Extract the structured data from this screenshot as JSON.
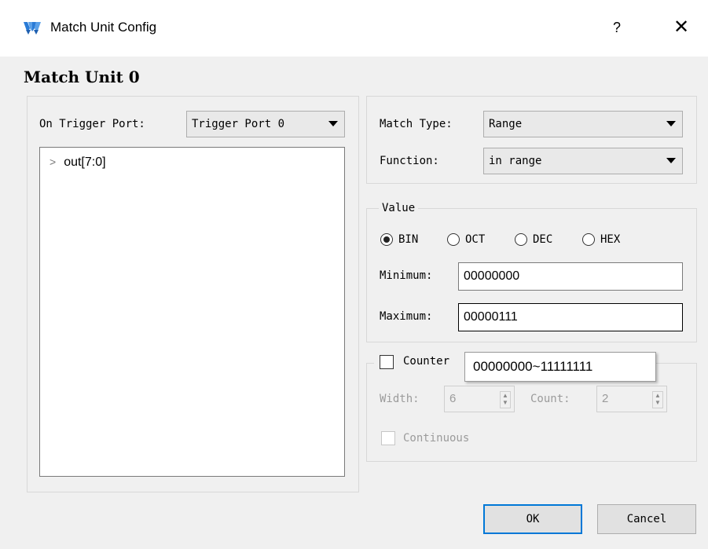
{
  "window": {
    "title": "Match Unit Config",
    "help_label": "?",
    "close_label": "✕",
    "logo_icon": "gowin-logo-icon",
    "accent_color": "#1e6ec8"
  },
  "heading": "Match Unit 0",
  "trigger": {
    "label": "On Trigger Port:",
    "value": "Trigger Port 0"
  },
  "tree": {
    "items": [
      {
        "label": "out[7:0]",
        "expanded": false
      }
    ]
  },
  "match": {
    "type_label": "Match Type:",
    "type_value": "Range",
    "function_label": "Function:",
    "function_value": "in range"
  },
  "value_group": {
    "title": "Value",
    "radios": [
      {
        "label": "BIN",
        "checked": true
      },
      {
        "label": "OCT",
        "checked": false
      },
      {
        "label": "DEC",
        "checked": false
      },
      {
        "label": "HEX",
        "checked": false
      }
    ],
    "minimum_label": "Minimum:",
    "minimum_value": "00000000",
    "maximum_label": "Maximum:",
    "maximum_value": "00000111"
  },
  "counter": {
    "label": "Counter",
    "checked": false,
    "width_label": "Width:",
    "width_value": "6",
    "count_label": "Count:",
    "count_value": "2",
    "continuous_label": "Continuous",
    "continuous_checked": false
  },
  "tooltip": "00000000~11111111",
  "buttons": {
    "ok": "OK",
    "cancel": "Cancel"
  }
}
